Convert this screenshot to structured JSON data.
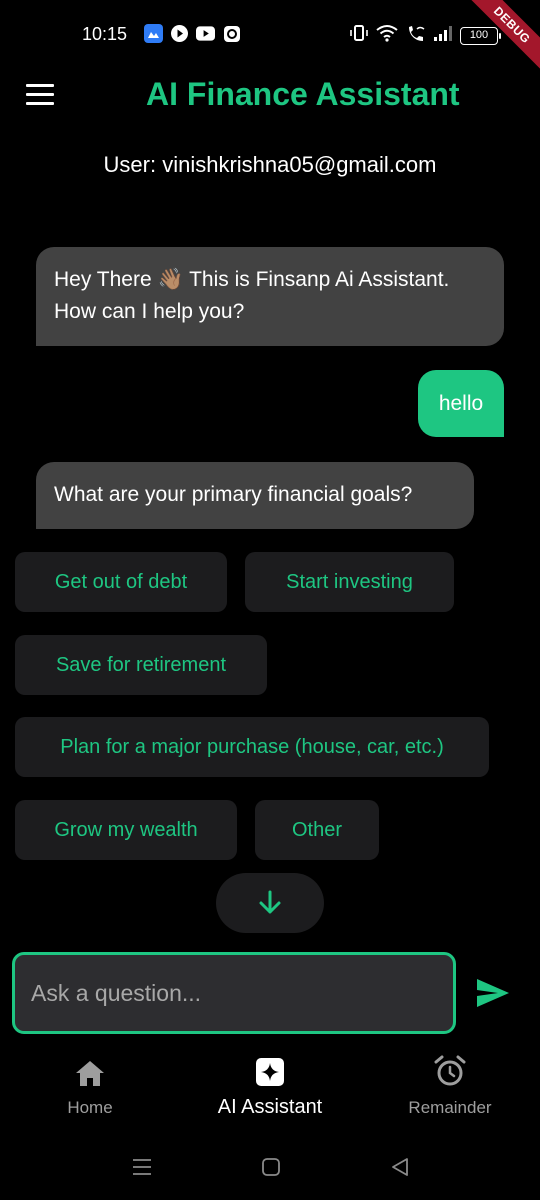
{
  "status_bar": {
    "time": "10:15",
    "battery": "100",
    "debug_banner": "DEBUG"
  },
  "app_bar": {
    "title": "AI Finance Assistant",
    "menu_icon": "hamburger-menu-icon"
  },
  "user_line": "User: vinishkrishna05@gmail.com",
  "messages": [
    {
      "sender": "bot",
      "text": "Hey There 👋🏽 This is Finsanp Ai Assistant. How can I help you?"
    },
    {
      "sender": "user",
      "text": "hello"
    },
    {
      "sender": "bot",
      "text": "What are your primary financial goals?"
    }
  ],
  "quick_replies": [
    "Get out of debt",
    "Start investing",
    "Save for retirement",
    "Plan for a major purchase (house, car, etc.)",
    "Grow my wealth",
    "Other"
  ],
  "scroll_down_icon": "arrow-down-icon",
  "input": {
    "placeholder": "Ask a question...",
    "value": ""
  },
  "send_icon": "send-icon",
  "bottom_nav": {
    "items": [
      {
        "label": "Home",
        "icon": "home-icon",
        "active": false
      },
      {
        "label": "AI Assistant",
        "icon": "sparkle-icon",
        "active": true
      },
      {
        "label": "Remainder",
        "icon": "alarm-clock-icon",
        "active": false
      }
    ]
  },
  "colors": {
    "accent": "#1ec682",
    "background": "#000000",
    "bot_bubble": "#424242",
    "chip_bg": "#1c1c1e",
    "debug_ribbon": "#a3172b"
  }
}
